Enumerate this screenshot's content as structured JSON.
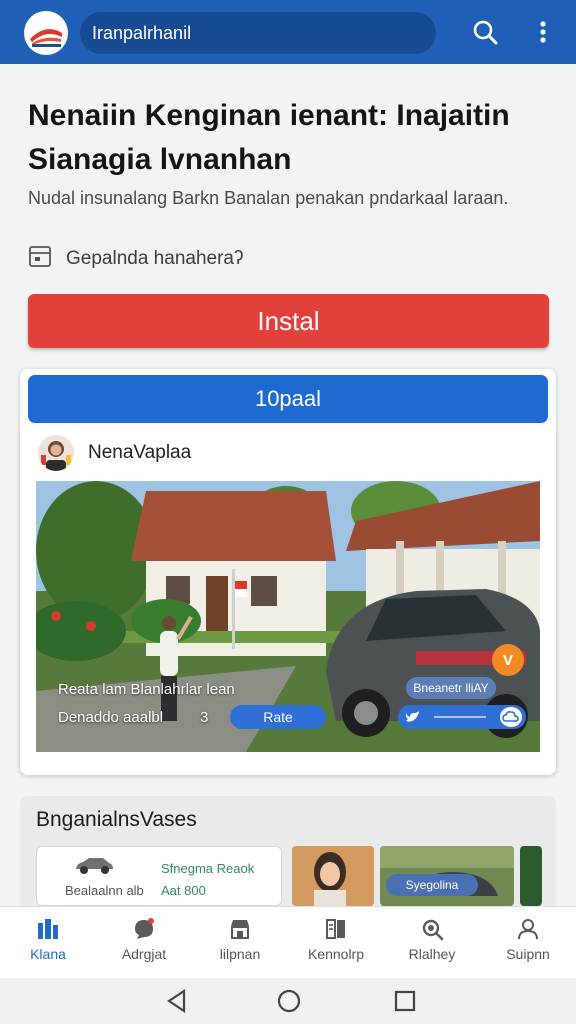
{
  "appbar": {
    "search_text": "Iranpalrhanil",
    "search_icon": "search-icon",
    "menu_icon": "more-vert-icon",
    "color": "#1f5fb5"
  },
  "main": {
    "headline": "Nenaiin Kenginan ienant: Inajaitin Sianagia lvnanhan",
    "subtitle": "Nudal insunalang Barkn Banalan penakan pndarkaal laraan.",
    "meta_text": "Gepalnda hanaheraʔ",
    "install_label": "Instal",
    "install_color": "#e2403a"
  },
  "card": {
    "tab_label": "10paal",
    "author_name": "NenaVaplaa",
    "photo_caption_line1": "Reata lam Blanlahrlar lean",
    "photo_caption_line2": "Denaddo aaalbl",
    "photo_number": "3",
    "chip_rate": "Rate",
    "chip_tag": "Bneanetr lliAY",
    "badge_glyph": "V"
  },
  "section": {
    "title": "BnganialnsVases",
    "mini_card_line1": "Sfnegma Reaok",
    "mini_card_line2": "Bealaalnn alb",
    "mini_card_line3": "Aat 800",
    "thumb_label": "Syegolina"
  },
  "bottom_nav": {
    "items": [
      {
        "label": "Klana",
        "icon": "home-icon",
        "active": true
      },
      {
        "label": "Adrgjat",
        "icon": "chat-icon",
        "active": false
      },
      {
        "label": "lilpnan",
        "icon": "store-icon",
        "active": false
      },
      {
        "label": "Kennolrp",
        "icon": "book-icon",
        "active": false
      },
      {
        "label": "Rlalhey",
        "icon": "search-icon",
        "active": false
      },
      {
        "label": "Suipnn",
        "icon": "profile-icon",
        "active": false
      }
    ]
  },
  "system_nav": {
    "back_icon": "back-triangle-icon",
    "home_icon": "home-circle-icon",
    "recents_icon": "recents-square-icon"
  }
}
